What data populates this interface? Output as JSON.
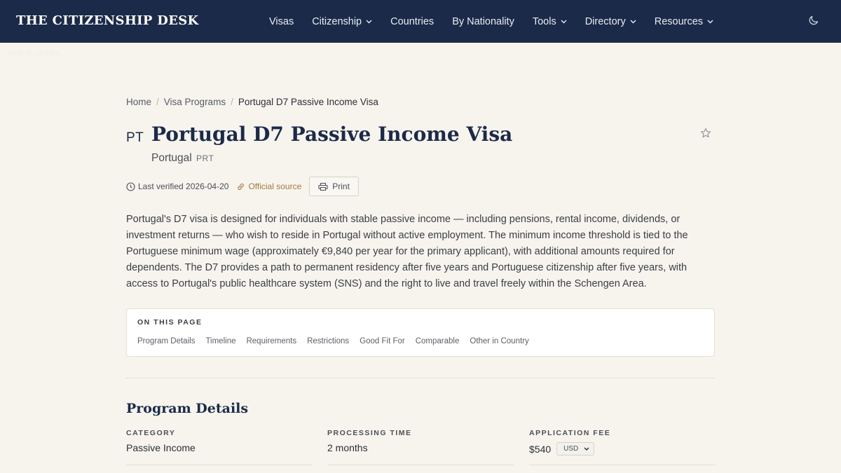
{
  "navbar": {
    "brand": "THE CITIZENSHIP DESK",
    "items": [
      {
        "label": "Visas",
        "dropdown": false
      },
      {
        "label": "Citizenship",
        "dropdown": true
      },
      {
        "label": "Countries",
        "dropdown": false
      },
      {
        "label": "By Nationality",
        "dropdown": false
      },
      {
        "label": "Tools",
        "dropdown": true
      },
      {
        "label": "Directory",
        "dropdown": true
      },
      {
        "label": "Resources",
        "dropdown": true
      }
    ],
    "theme_toggle_icon": "moon-icon"
  },
  "skip_link": "Skip to content",
  "breadcrumb": {
    "home": "Home",
    "section": "Visa Programs",
    "current": "Portugal D7 Passive Income Visa"
  },
  "header": {
    "country_code": "PT",
    "title": "Portugal D7 Passive Income Visa",
    "country": "Portugal",
    "iso3": "PRT"
  },
  "meta": {
    "last_verified_label": "Last verified",
    "last_verified_date": "2026-04-20",
    "official_source": "Official source",
    "print": "Print"
  },
  "description": "Portugal's D7 visa is designed for individuals with stable passive income — including pensions, rental income, dividends, or investment returns — who wish to reside in Portugal without active employment. The minimum income threshold is tied to the Portuguese minimum wage (approximately €9,840 per year for the primary applicant), with additional amounts required for dependents. The D7 provides a path to permanent residency after five years and Portuguese citizenship after five years, with access to Portugal's public healthcare system (SNS) and the right to live and travel freely within the Schengen Area.",
  "toc": {
    "heading": "ON THIS PAGE",
    "links": [
      "Program Details",
      "Timeline",
      "Requirements",
      "Restrictions",
      "Good Fit For",
      "Comparable",
      "Other in Country"
    ]
  },
  "program_details": {
    "title": "Program Details",
    "category": {
      "label": "CATEGORY",
      "value": "Passive Income"
    },
    "processing_time": {
      "label": "PROCESSING TIME",
      "value": "2 months"
    },
    "application_fee": {
      "label": "APPLICATION FEE",
      "value": "$540",
      "currency": "USD"
    }
  },
  "colors": {
    "navbar_bg": "#1b2a48",
    "page_bg": "#f7f4ee",
    "accent_link": "#a27a3c",
    "title_text": "#1b2a48"
  }
}
